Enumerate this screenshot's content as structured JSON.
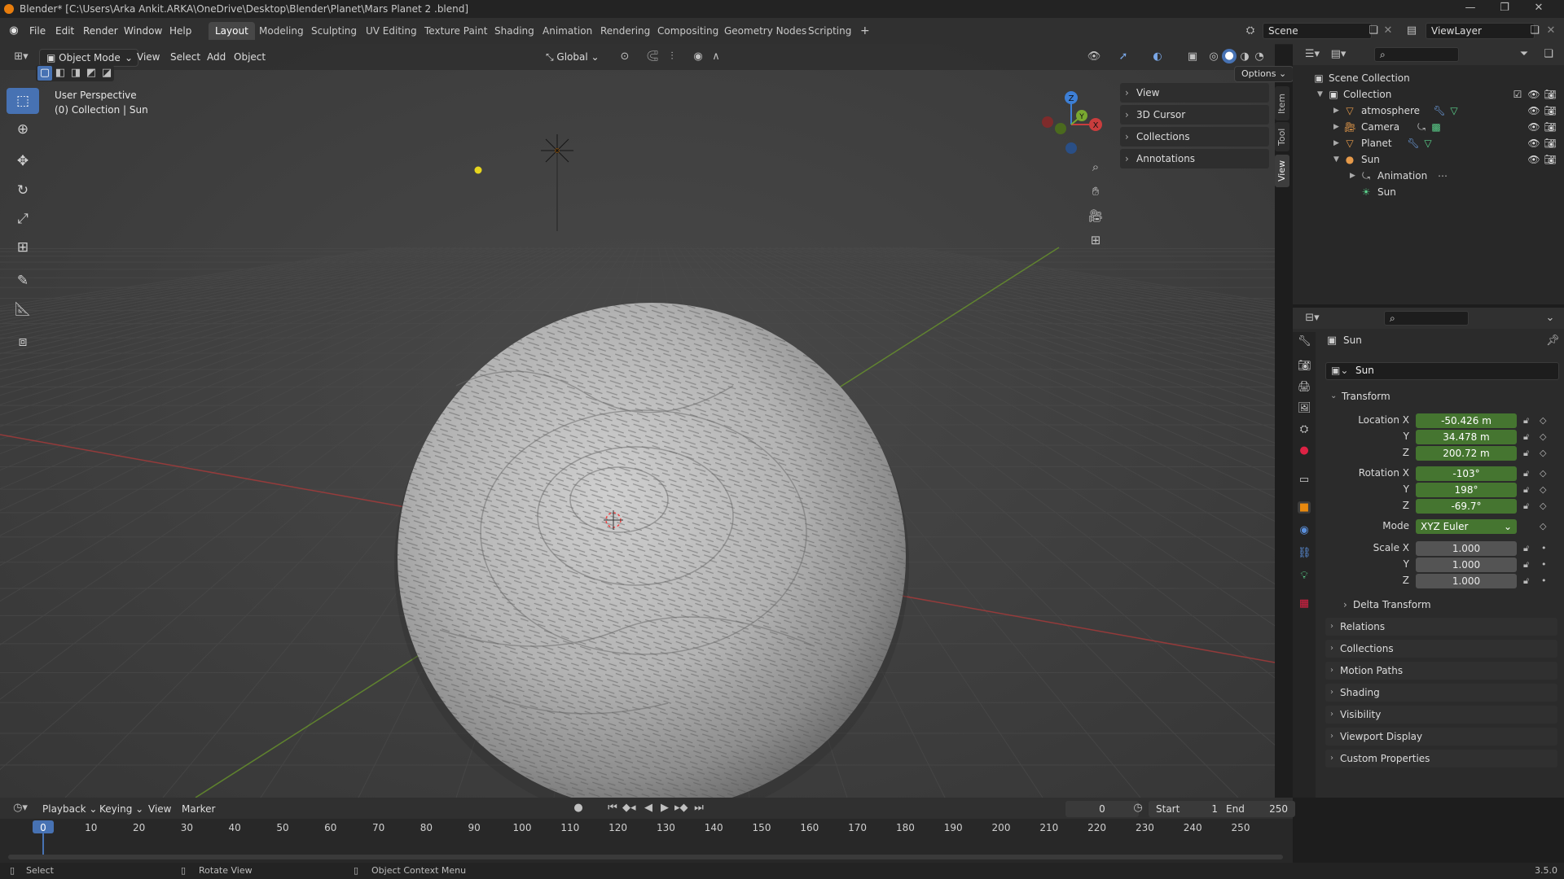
{
  "window": {
    "title": "Blender* [C:\\Users\\Arka Ankit.ARKA\\OneDrive\\Desktop\\Blender\\Planet\\Mars Planet 2 .blend]"
  },
  "menubar": {
    "menus": [
      "File",
      "Edit",
      "Render",
      "Window",
      "Help"
    ],
    "workspaces": [
      "Layout",
      "Modeling",
      "Sculpting",
      "UV Editing",
      "Texture Paint",
      "Shading",
      "Animation",
      "Rendering",
      "Compositing",
      "Geometry Nodes",
      "Scripting"
    ],
    "active_workspace": "Layout",
    "add_tab": "+",
    "scene": "Scene",
    "view_layer": "ViewLayer"
  },
  "viewport_header": {
    "mode": "Object Mode",
    "menus": [
      "View",
      "Select",
      "Add",
      "Object"
    ],
    "orientation": "Global",
    "options": "Options"
  },
  "viewport": {
    "perspective": "User Perspective",
    "collection_info": "(0) Collection | Sun"
  },
  "gizmo": {
    "x": "X",
    "y": "Y",
    "z": "Z"
  },
  "npanel": {
    "sections": [
      "View",
      "3D Cursor",
      "Collections",
      "Annotations"
    ],
    "tabs": [
      "Item",
      "Tool",
      "View"
    ]
  },
  "outliner": {
    "root": "Scene Collection",
    "collection": "Collection",
    "items": [
      "atmosphere",
      "Camera",
      "Planet",
      "Sun"
    ],
    "sun_children": [
      "Animation",
      "Sun"
    ]
  },
  "properties": {
    "object_name": "Sun",
    "data_name": "Sun",
    "transform_label": "Transform",
    "location_label": "Location X",
    "rotation_label": "Rotation X",
    "scale_label": "Scale X",
    "axis_y": "Y",
    "axis_z": "Z",
    "location": [
      "-50.426 m",
      "34.478 m",
      "200.72 m"
    ],
    "rotation": [
      "-103°",
      "198°",
      "-69.7°"
    ],
    "mode_label": "Mode",
    "mode_value": "XYZ Euler",
    "scale": [
      "1.000",
      "1.000",
      "1.000"
    ],
    "delta_transform": "Delta Transform",
    "sections": [
      "Relations",
      "Collections",
      "Motion Paths",
      "Shading",
      "Visibility",
      "Viewport Display",
      "Custom Properties"
    ]
  },
  "timeline": {
    "menus": [
      "Playback",
      "Keying",
      "View",
      "Marker"
    ],
    "current_frame": "0",
    "start_label": "Start",
    "start": "1",
    "end_label": "End",
    "end": "250",
    "ticks": [
      "0",
      "10",
      "20",
      "30",
      "40",
      "50",
      "60",
      "70",
      "80",
      "90",
      "100",
      "110",
      "120",
      "130",
      "140",
      "150",
      "160",
      "170",
      "180",
      "190",
      "200",
      "210",
      "220",
      "230",
      "240",
      "250"
    ]
  },
  "statusbar": {
    "select": "Select",
    "rotate": "Rotate View",
    "context": "Object Context Menu",
    "version": "3.5.0"
  },
  "colors": {
    "accent": "#4772b3",
    "field_green": "#457530",
    "x_axis": "#c93d3d",
    "y_axis": "#79a830",
    "z_axis": "#3d7fd6"
  }
}
